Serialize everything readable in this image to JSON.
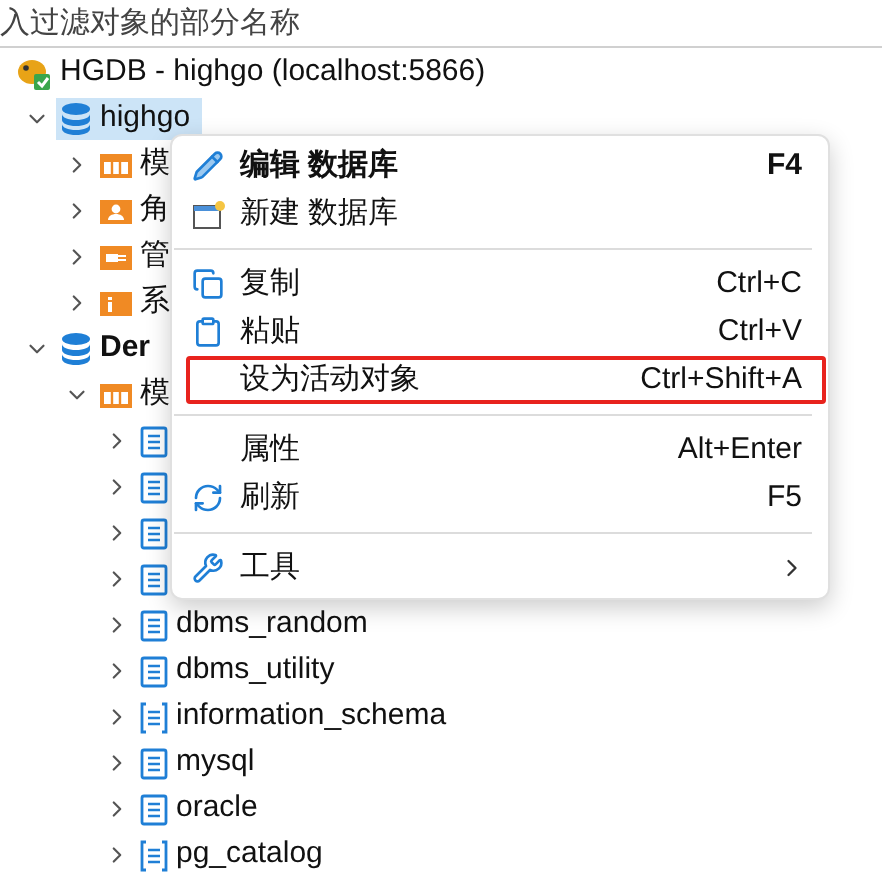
{
  "filter": {
    "placeholder": "入过滤对象的部分名称"
  },
  "tree": [
    {
      "kind": "connection",
      "label": "HGDB - highgo (localhost:5866)",
      "children": [
        {
          "kind": "database",
          "label": "highgo",
          "expanded": true,
          "selected": true,
          "children": [
            {
              "kind": "schemas",
              "label": "模",
              "expanded": false,
              "selected": false
            },
            {
              "kind": "roles",
              "label": "角",
              "expanded": false,
              "selected": false
            },
            {
              "kind": "admin",
              "label": "管",
              "expanded": false,
              "selected": false
            },
            {
              "kind": "system",
              "label": "系",
              "expanded": false,
              "selected": false
            }
          ]
        },
        {
          "kind": "database",
          "label": "Der",
          "expanded": true,
          "selected": false,
          "bold": true,
          "children": [
            {
              "kind": "schemas",
              "label": "模",
              "expanded": true,
              "selected": false,
              "children": [
                {
                  "kind": "schema",
                  "expanded": false,
                  "selected": false
                },
                {
                  "kind": "schema",
                  "expanded": false,
                  "selected": false
                },
                {
                  "kind": "schema",
                  "expanded": false,
                  "selected": false
                },
                {
                  "kind": "schema",
                  "expanded": false,
                  "selected": false
                },
                {
                  "kind": "schema",
                  "label": "dbms_random",
                  "expanded": false,
                  "selected": false
                },
                {
                  "kind": "schema",
                  "label": "dbms_utility",
                  "expanded": false,
                  "selected": false
                },
                {
                  "kind": "system_schema",
                  "label": "information_schema",
                  "expanded": false,
                  "selected": false
                },
                {
                  "kind": "schema",
                  "label": "mysql",
                  "expanded": false,
                  "selected": false
                },
                {
                  "kind": "schema",
                  "label": "oracle",
                  "expanded": false,
                  "selected": false
                },
                {
                  "kind": "system_schema",
                  "label": "pg_catalog",
                  "expanded": false,
                  "selected": false
                }
              ]
            }
          ]
        }
      ]
    }
  ],
  "context_menu": [
    {
      "kind": "edit",
      "label": "编辑 数据库",
      "shortcut": "F4",
      "bold": true,
      "highlighted": false
    },
    {
      "kind": "new",
      "label": "新建 数据库",
      "bold": false,
      "highlighted": false
    },
    {
      "kind": "separator"
    },
    {
      "kind": "copy",
      "label": "复制",
      "shortcut": "Ctrl+C",
      "bold": false,
      "highlighted": false
    },
    {
      "kind": "paste",
      "label": "粘贴",
      "shortcut": "Ctrl+V",
      "bold": false,
      "highlighted": false
    },
    {
      "kind": "plain",
      "label": "设为活动对象",
      "shortcut": "Ctrl+Shift+A",
      "bold": false,
      "highlighted": true
    },
    {
      "kind": "separator"
    },
    {
      "kind": "plain",
      "label": "属性",
      "shortcut": "Alt+Enter",
      "bold": false,
      "highlighted": false
    },
    {
      "kind": "refresh",
      "label": "刷新",
      "shortcut": "F5",
      "bold": false,
      "highlighted": false
    },
    {
      "kind": "separator"
    },
    {
      "kind": "tools",
      "label": "工具",
      "submenu": true,
      "bold": false,
      "highlighted": false
    }
  ]
}
